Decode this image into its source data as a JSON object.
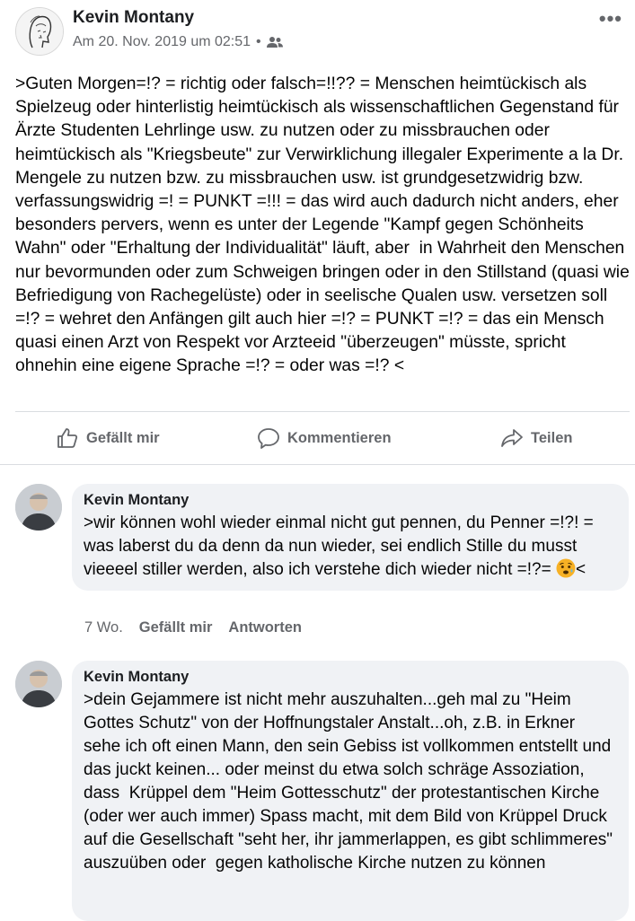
{
  "post": {
    "author": "Kevin Montany",
    "timestamp": "Am 20. Nov. 2019 um 02:51",
    "separator": "•",
    "audience_icon": "friends-icon",
    "more_icon": "•••",
    "text": ">Guten Morgen=!? = richtig oder falsch=!!?? = Menschen heimtückisch als Spielzeug oder hinterlistig heimtückisch als wissenschaftlichen Gegenstand für Ärzte Studenten Lehrlinge usw. zu nutzen oder zu missbrauchen oder heimtückisch als \"Kriegsbeute\" zur Verwirklichung illegaler Experimente a la Dr. Mengele zu nutzen bzw. zu missbrauchen usw. ist grundgesetzwidrig bzw. verfassungswidrig =! = PUNKT =!!! = das wird auch dadurch nicht anders, eher besonders pervers, wenn es unter der Legende \"Kampf gegen Schönheits Wahn\" oder \"Erhaltung der Individualität\" läuft, aber  in Wahrheit den Menschen nur bevormunden oder zum Schweigen bringen oder in den Stillstand (quasi wie Befriedigung von Rachegelüste) oder in seelische Qualen usw. versetzen soll =!? = wehret den Anfängen gilt auch hier =!? = PUNKT =!? = das ein Mensch quasi einen Arzt von Respekt vor Arzteeid \"überzeugen\" müsste, spricht ohnehin eine eigene Sprache =!? = oder was =!? <"
  },
  "actions": {
    "like": "Gefällt mir",
    "comment": "Kommentieren",
    "share": "Teilen"
  },
  "comments": [
    {
      "author": "Kevin Montany",
      "text": ">wir können wohl wieder einmal nicht gut pennen, du Penner =!?! = was laberst du da denn da nun wieder, sei endlich Stille du musst vieeeel stiller werden, also ich verstehe dich wieder nicht =!?= ",
      "text_end": "<",
      "emoji": "anxious-face-emoji",
      "age": "7 Wo.",
      "like": "Gefällt mir",
      "reply": "Antworten"
    },
    {
      "author": "Kevin Montany",
      "text": ">dein Gejammere ist nicht mehr auszuhalten...geh mal zu \"Heim Gottes Schutz\" von der Hoffnungstaler Anstalt...oh, z.B. in Erkner sehe ich oft einen Mann, den sein Gebiss ist vollkommen entstellt und das juckt keinen... oder meinst du etwa solch schräge Assoziation, dass  Krüppel dem \"Heim Gottesschutz\" der protestantischen Kirche (oder wer auch immer) Spass macht, mit dem Bild von Krüppel Druck auf die Gesellschaft \"seht her, ihr jammerlappen, es gibt schlimmeres\" auszuüben oder  gegen katholische Kirche nutzen zu können"
    }
  ]
}
